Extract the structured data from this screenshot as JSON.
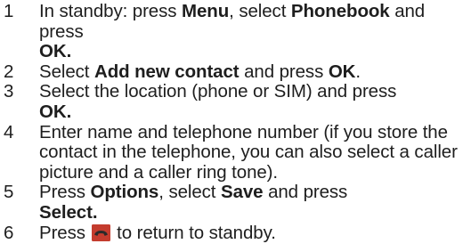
{
  "steps": [
    {
      "number": "1",
      "parts": [
        {
          "t": "In standby: press ",
          "b": false
        },
        {
          "t": "Menu",
          "b": true
        },
        {
          "t": ", select ",
          "b": false
        },
        {
          "t": "Phonebook",
          "b": true
        },
        {
          "t": " and press ",
          "b": false
        },
        {
          "t": "OK",
          "b": true
        },
        {
          "t": ".",
          "b": true
        }
      ]
    },
    {
      "number": "2",
      "parts": [
        {
          "t": "Select ",
          "b": false
        },
        {
          "t": "Add new contact",
          "b": true
        },
        {
          "t": " and press ",
          "b": false
        },
        {
          "t": "OK",
          "b": true
        },
        {
          "t": ".",
          "b": false
        }
      ]
    },
    {
      "number": "3",
      "parts": [
        {
          "t": "Select the location (phone or SIM) and press ",
          "b": false
        },
        {
          "t": "OK",
          "b": true
        },
        {
          "t": ".",
          "b": true
        }
      ]
    },
    {
      "number": "4",
      "parts": [
        {
          "t": "Enter name and telephone number (if you store the contact in the telephone, you can also select a caller picture and a caller ring tone).",
          "b": false
        }
      ]
    },
    {
      "number": "5",
      "parts": [
        {
          "t": "Press ",
          "b": false
        },
        {
          "t": "Options",
          "b": true
        },
        {
          "t": ", select ",
          "b": false
        },
        {
          "t": "Save",
          "b": true
        },
        {
          "t": " and press ",
          "b": false
        },
        {
          "t": "Select",
          "b": true
        },
        {
          "t": ".",
          "b": true
        }
      ]
    }
  ],
  "step6": {
    "number": "6",
    "before": "Press ",
    "icon": "end-call-icon",
    "after": " to return to standby."
  },
  "colors": {
    "text": "#1e1e1e",
    "icon_background": "#c43c2e",
    "icon_handset": "#2a2a2a"
  }
}
